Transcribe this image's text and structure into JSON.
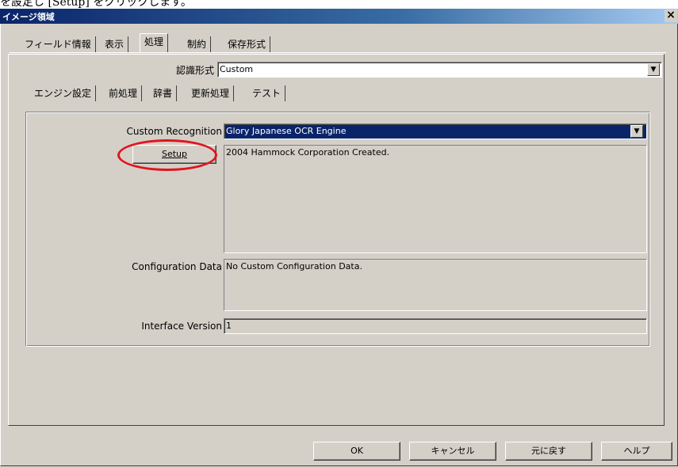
{
  "top_caption": "を設定し [Setup] をクリックします。",
  "window": {
    "title": "イメージ領域",
    "close_glyph": "×"
  },
  "main_tabs": [
    "フィールド情報",
    "表示",
    "処理",
    "制約",
    "保存形式"
  ],
  "recognition_format": {
    "label": "認識形式",
    "value": "Custom"
  },
  "sub_tabs": [
    "エンジン設定",
    "前処理",
    "辞書",
    "更新処理",
    "テスト"
  ],
  "custom_recognition": {
    "label": "Custom Recognition",
    "value": "Glory Japanese OCR Engine"
  },
  "setup_button": "Setup",
  "description_text": "2004 Hammock Corporation Created.",
  "configuration_data": {
    "label": "Configuration Data",
    "value": "No Custom Configuration Data."
  },
  "interface_version": {
    "label": "Interface Version",
    "value": "1"
  },
  "buttons": {
    "ok": "OK",
    "cancel": "キャンセル",
    "revert": "元に戻す",
    "help": "ヘルプ"
  },
  "icons": {
    "dropdown": "▼"
  },
  "colors": {
    "titlebar": "#0a246a",
    "selection": "#0a246a",
    "highlight_ellipse": "#e0141e",
    "face": "#d4d0c8"
  }
}
